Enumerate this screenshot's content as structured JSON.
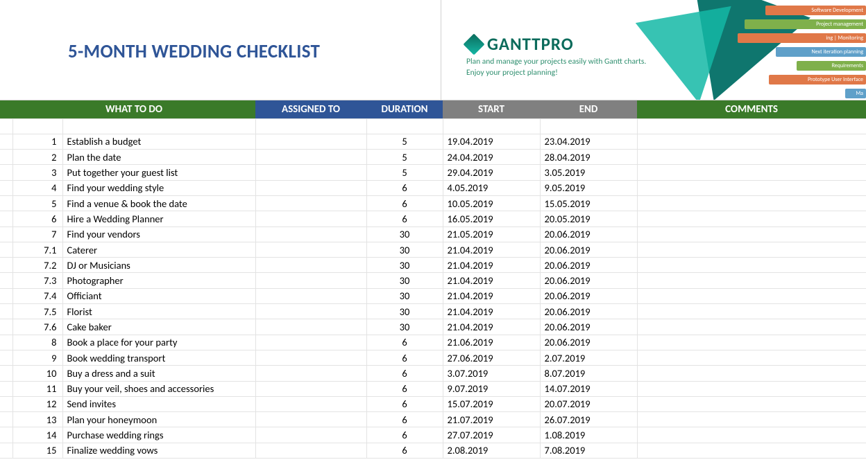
{
  "title": "5-MONTH WEDDING CHECKLIST",
  "brand": {
    "name": "GANTTPRO",
    "tagline_l1": "Plan and manage your projects easily with Gantt charts.",
    "tagline_l2": "Enjoy your project planning!",
    "bars": [
      {
        "label": "Software Development",
        "color": "#e07848",
        "ml": 40
      },
      {
        "label": "Project management",
        "color": "#7fb04b",
        "ml": 10
      },
      {
        "label": "ing | Monitoring",
        "color": "#e07848",
        "ml": 0
      },
      {
        "label": "Next iteration planning",
        "color": "#5fa0c9",
        "ml": 55
      },
      {
        "label": "Requirements",
        "color": "#7fb04b",
        "ml": 85
      },
      {
        "label": "Prototype User Interface",
        "color": "#e07848",
        "ml": 45
      },
      {
        "label": "Ma",
        "color": "#5fa0c9",
        "ml": 155
      }
    ]
  },
  "headers": {
    "what": "WHAT TO DO",
    "assigned": "ASSIGNED TO",
    "duration": "DURATION",
    "start": "START",
    "end": "END",
    "comments": "COMMENTS"
  },
  "rows": [
    {
      "n": "1",
      "task": "Establish a budget",
      "dur": "5",
      "start": "19.04.2019",
      "end": "23.04.2019"
    },
    {
      "n": "2",
      "task": "Plan the date",
      "dur": "5",
      "start": "24.04.2019",
      "end": "28.04.2019"
    },
    {
      "n": "3",
      "task": "Put together your guest list",
      "dur": "5",
      "start": "29.04.2019",
      "end": "3.05.2019"
    },
    {
      "n": "4",
      "task": "Find your wedding style",
      "dur": "6",
      "start": "4.05.2019",
      "end": "9.05.2019"
    },
    {
      "n": "5",
      "task": "Find a venue & book the date",
      "dur": "6",
      "start": "10.05.2019",
      "end": "15.05.2019"
    },
    {
      "n": "6",
      "task": "Hire a Wedding Planner",
      "dur": "6",
      "start": "16.05.2019",
      "end": "20.05.2019"
    },
    {
      "n": "7",
      "task": "Find your vendors",
      "dur": "30",
      "start": "21.05.2019",
      "end": "20.06.2019"
    },
    {
      "n": "7.1",
      "task": "Caterer",
      "dur": "30",
      "start": "21.04.2019",
      "end": "20.06.2019"
    },
    {
      "n": "7.2",
      "task": "DJ or Musicians",
      "dur": "30",
      "start": "21.04.2019",
      "end": "20.06.2019"
    },
    {
      "n": "7.3",
      "task": "Photographer",
      "dur": "30",
      "start": "21.04.2019",
      "end": "20.06.2019"
    },
    {
      "n": "7.4",
      "task": "Officiant",
      "dur": "30",
      "start": "21.04.2019",
      "end": "20.06.2019"
    },
    {
      "n": "7.5",
      "task": "Florist",
      "dur": "30",
      "start": "21.04.2019",
      "end": "20.06.2019"
    },
    {
      "n": "7.6",
      "task": "Cake baker",
      "dur": "30",
      "start": "21.04.2019",
      "end": "20.06.2019"
    },
    {
      "n": "8",
      "task": "Book a place for your party",
      "dur": "6",
      "start": "21.06.2019",
      "end": "20.06.2019"
    },
    {
      "n": "9",
      "task": "Book wedding transport",
      "dur": "6",
      "start": "27.06.2019",
      "end": "2.07.2019"
    },
    {
      "n": "10",
      "task": "Buy a dress and a suit",
      "dur": "6",
      "start": "3.07.2019",
      "end": "8.07.2019"
    },
    {
      "n": "11",
      "task": "Buy your veil, shoes and accessories",
      "dur": "6",
      "start": "9.07.2019",
      "end": "14.07.2019"
    },
    {
      "n": "12",
      "task": "Send invites",
      "dur": "6",
      "start": "15.07.2019",
      "end": "20.07.2019"
    },
    {
      "n": "13",
      "task": "Plan your honeymoon",
      "dur": "6",
      "start": "21.07.2019",
      "end": "26.07.2019"
    },
    {
      "n": "14",
      "task": "Purchase wedding rings",
      "dur": "6",
      "start": "27.07.2019",
      "end": "1.08.2019"
    },
    {
      "n": "15",
      "task": "Finalize wedding vows",
      "dur": "6",
      "start": "2.08.2019",
      "end": "7.08.2019"
    }
  ]
}
